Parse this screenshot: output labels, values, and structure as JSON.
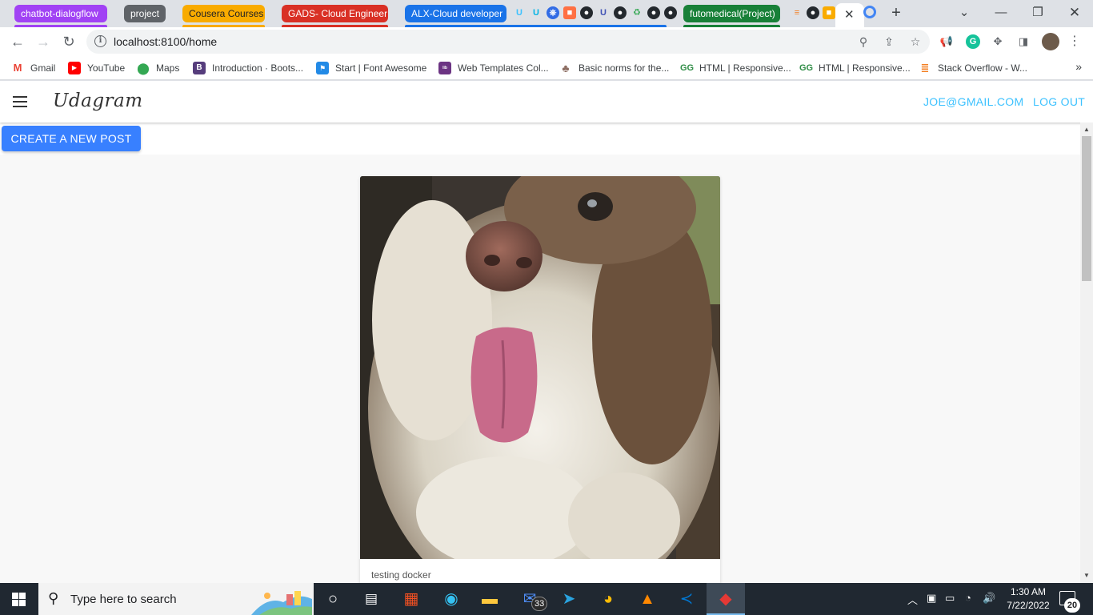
{
  "browser": {
    "tab_groups": [
      {
        "label": "chatbot-dialogflow",
        "color": "#a142f4"
      },
      {
        "label": "project",
        "color": "#5f6368"
      },
      {
        "label": "Cousera Courses",
        "color": "#f9ab00"
      },
      {
        "label": "GADS- Cloud Engineer",
        "color": "#d93025"
      },
      {
        "label": "ALX-Cloud developer",
        "color": "#1a73e8"
      },
      {
        "label": "futomedical(Project)",
        "color": "#188038"
      }
    ],
    "url": "localhost:8100/home",
    "bookmarks": [
      {
        "label": "Gmail",
        "icon": "gmail-icon"
      },
      {
        "label": "YouTube",
        "icon": "youtube-icon"
      },
      {
        "label": "Maps",
        "icon": "maps-icon"
      },
      {
        "label": "Introduction · Boots...",
        "icon": "bootstrap-icon"
      },
      {
        "label": "Start | Font Awesome",
        "icon": "flag-icon"
      },
      {
        "label": "Web Templates Col...",
        "icon": "colorlib-icon"
      },
      {
        "label": "Basic norms for the...",
        "icon": "tree-icon"
      },
      {
        "label": "HTML | Responsive...",
        "icon": "geeksforgeeks-icon"
      },
      {
        "label": "HTML | Responsive...",
        "icon": "geeksforgeeks-icon"
      },
      {
        "label": "Stack Overflow - W...",
        "icon": "stackoverflow-icon"
      }
    ]
  },
  "app": {
    "brand": "Udagram",
    "user_email": "JOE@GMAIL.COM",
    "logout_label": "LOG OUT",
    "create_post_label": "CREATE A NEW POST",
    "posts": [
      {
        "caption": "testing docker",
        "image": "photo of a brown and white dog with tongue out"
      }
    ],
    "accent_color": "#3dc2ff",
    "primary_color": "#3880ff"
  },
  "taskbar": {
    "search_placeholder": "Type here to search",
    "mail_badge": "33",
    "time": "1:30 AM",
    "date": "7/22/2022",
    "notification_count": "20"
  }
}
